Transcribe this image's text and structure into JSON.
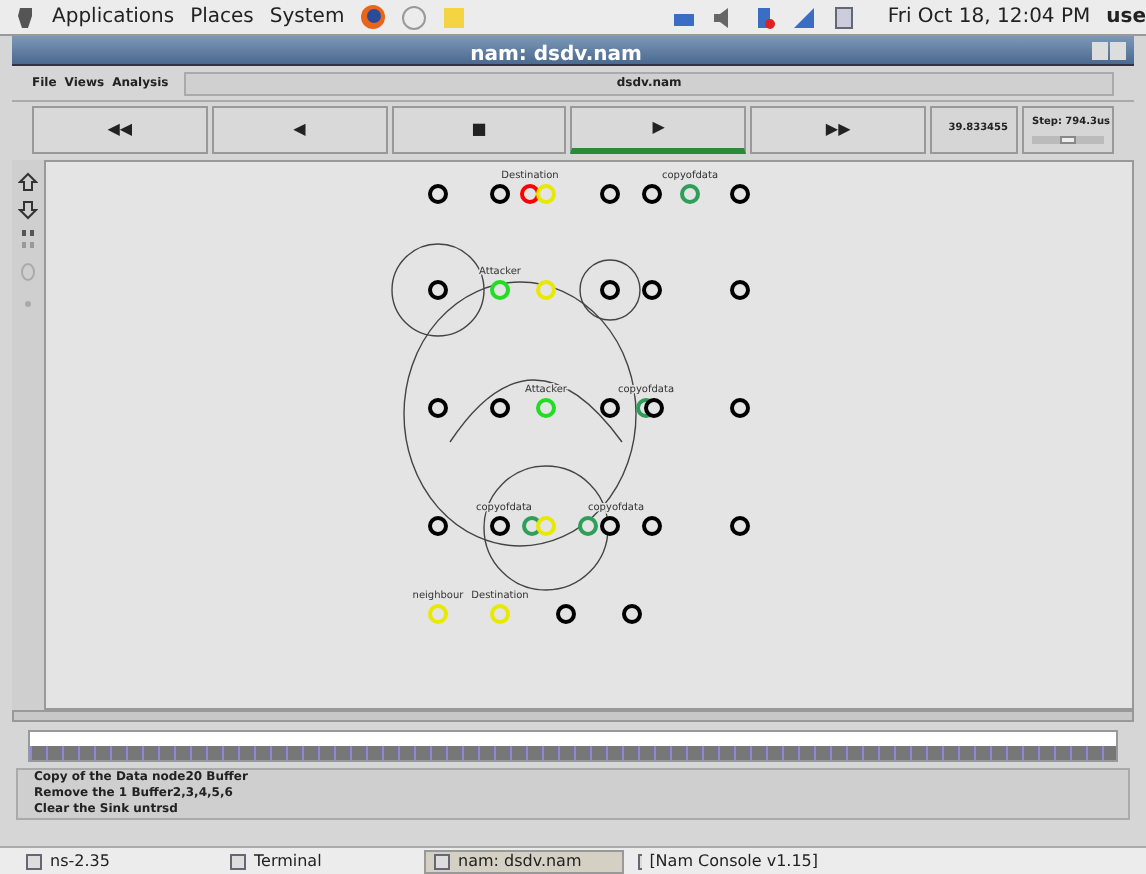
{
  "top_panel": {
    "menus": [
      "Applications",
      "Places",
      "System"
    ],
    "clock": "Fri Oct 18, 12:04 PM",
    "user": "use"
  },
  "window": {
    "title": "nam: dsdv.nam"
  },
  "menu": [
    "File",
    "Views",
    "Analysis"
  ],
  "file_label": "dsdv.nam",
  "controls": [
    {
      "label": "◀◀",
      "selected": false
    },
    {
      "label": "◀",
      "selected": false
    },
    {
      "label": "■",
      "selected": false
    },
    {
      "label": "▶",
      "selected": true
    },
    {
      "label": "▶▶",
      "selected": false
    }
  ],
  "time": "39.833455",
  "step": {
    "label": "Step: 794.3us",
    "level": 0.5
  },
  "nodes": [
    {
      "color": "#000000"
    },
    {
      "color": "#000000"
    },
    {
      "color": "#ff0000",
      "label": "Destination"
    },
    {
      "color": "#e8e800"
    },
    {
      "color": "#000000"
    },
    {
      "color": "#000000"
    },
    {
      "color": "#2e9e5a",
      "label": "copyofdata"
    },
    {
      "color": "#000000"
    },
    {
      "color": "#000000"
    },
    {
      "color": "#22dd22",
      "label": "Attacker"
    },
    {
      "color": "#e8e800"
    },
    {
      "color": "#000000"
    },
    {
      "color": "#000000"
    },
    {
      "color": "#000000"
    },
    {
      "color": "#000000"
    },
    {
      "color": "#000000"
    },
    {
      "color": "#22dd22",
      "label": "Attacker"
    },
    {
      "color": "#000000"
    },
    {
      "color": "#2e9e5a",
      "label": "copyofdata"
    },
    {
      "color": "#000000"
    },
    {
      "color": "#000000"
    },
    {
      "color": "#000000"
    },
    {
      "color": "#000000"
    },
    {
      "color": "#2e9e5a",
      "label": "copyofdata"
    },
    {
      "color": "#e8e800"
    },
    {
      "color": "#2e9e5a",
      "label": "copyofdata"
    },
    {
      "color": "#000000"
    },
    {
      "color": "#000000"
    },
    {
      "color": "#000000"
    },
    {
      "color": "#e8e800",
      "label": "neighbour"
    },
    {
      "color": "#e8e800",
      "label": "Destination"
    },
    {
      "color": "#000000"
    },
    {
      "color": "#000000"
    }
  ],
  "messages": [
    "Copy of the Data node20 Buffer",
    "Remove the 1 Buffer2,3,4,5,6",
    "Clear the Sink untrsd"
  ],
  "taskbar": [
    {
      "label": "ns-2.35",
      "selected": false
    },
    {
      "label": "Terminal",
      "selected": false
    },
    {
      "label": "nam: dsdv.nam",
      "selected": true
    },
    {
      "label": "[Nam Console v1.15]",
      "selected": false
    }
  ]
}
